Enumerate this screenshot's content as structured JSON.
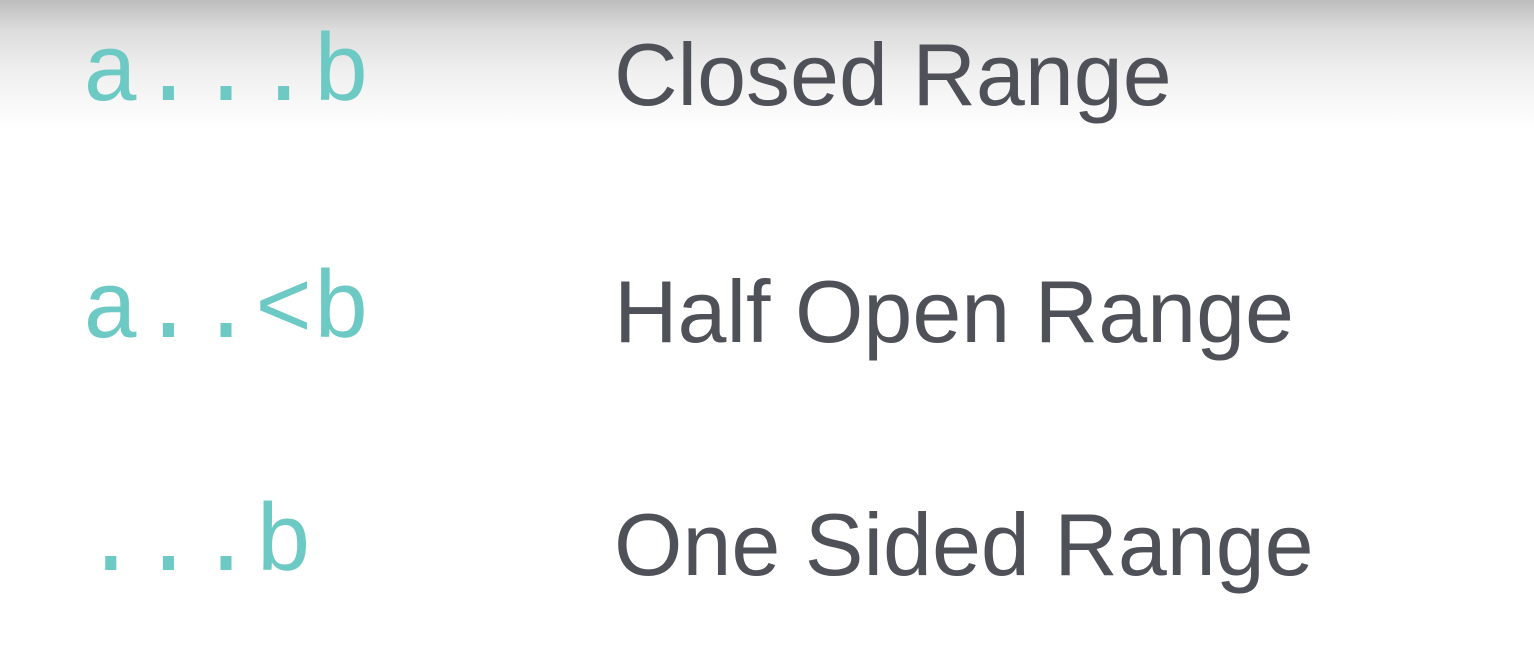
{
  "ranges": [
    {
      "syntax": "a...b",
      "name": "Closed Range"
    },
    {
      "syntax": "a..<b",
      "name": "Half Open Range"
    },
    {
      "syntax": "...b",
      "name": "One Sided Range"
    }
  ],
  "colors": {
    "code": "#6cc9c3",
    "label": "#4e5158",
    "background": "#ffffff"
  }
}
